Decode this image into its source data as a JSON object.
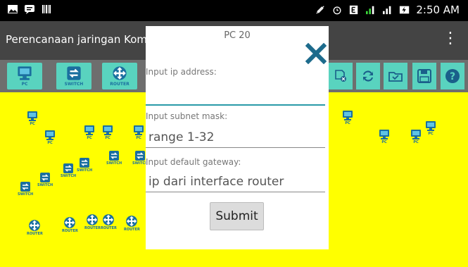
{
  "status": {
    "time": "2:50 AM"
  },
  "app": {
    "title": "Perencanaan jaringan Komputer"
  },
  "toolbar": {
    "pc_label": "PC",
    "switch_label": "SWITCH",
    "router_label": "ROUTER"
  },
  "canvas": {
    "pcs": [
      "PC",
      "PC",
      "PC",
      "PC",
      "PC",
      "PC",
      "PC",
      "PC",
      "PC"
    ],
    "switches": [
      "SWITCH",
      "SWITCH",
      "SWITCH",
      "SWITCH",
      "SWITCH",
      "SWITCH"
    ],
    "routers": [
      "ROUTER",
      "ROUTER",
      "ROUTER",
      "ROUTER",
      "ROUTER"
    ]
  },
  "dialog": {
    "title": "PC 20",
    "ip_label": "Input ip address:",
    "ip_value": "",
    "subnet_label": "Input subnet mask:",
    "subnet_placeholder": "range 1-32",
    "gateway_label": "Input default gateway:",
    "gateway_placeholder": "ip dari interface router",
    "submit_label": "Submit"
  },
  "colors": {
    "canvas": "#ffff00",
    "toolbar_button": "#59d3bf",
    "icon_blue": "#1a6f9f",
    "close_x": "#1d6b8c"
  }
}
